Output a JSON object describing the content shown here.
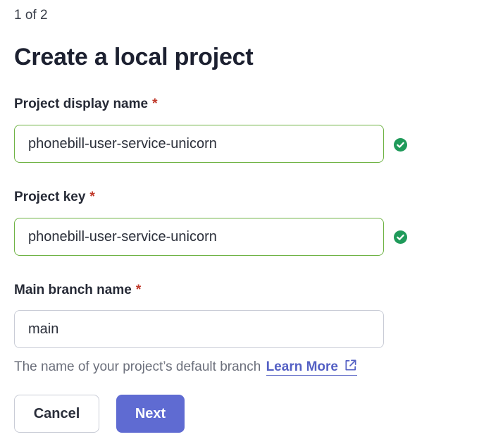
{
  "wizard": {
    "step": "1 of 2",
    "title": "Create a local project"
  },
  "fields": {
    "display_name": {
      "label": "Project display name",
      "required_mark": "*",
      "value": "phonebill-user-service-unicorn",
      "status": "valid"
    },
    "project_key": {
      "label": "Project key",
      "required_mark": "*",
      "value": "phonebill-user-service-unicorn",
      "status": "valid"
    },
    "main_branch": {
      "label": "Main branch name",
      "required_mark": "*",
      "value": "main",
      "help": "The name of your project’s default branch",
      "help_link": "Learn More"
    }
  },
  "actions": {
    "cancel": "Cancel",
    "next": "Next"
  },
  "icons": {
    "valid": "check-circle-icon",
    "external": "external-link-icon"
  },
  "colors": {
    "accent": "#5f6bd2",
    "link": "#5460c4",
    "valid": "#1f9a5a",
    "valid_border": "#6fb344",
    "required": "#c0392b"
  }
}
